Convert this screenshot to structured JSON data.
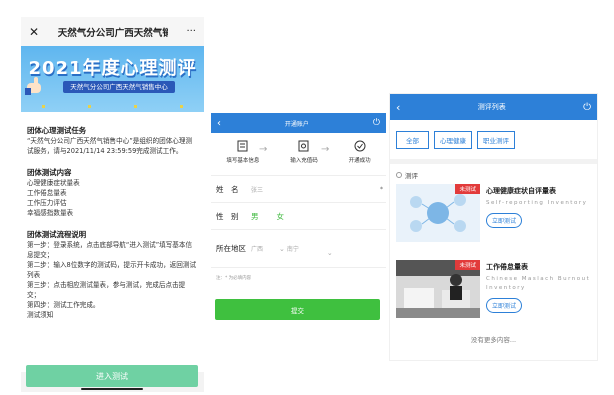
{
  "screen1": {
    "title": "天然气分公司广西天然气销",
    "banner_title": "2021年度心理测评",
    "banner_subtitle": "天然气分公司广西天然气销售中心",
    "sections": [
      {
        "heading": "团体心理测试任务",
        "lines": [
          "“天然气分公司广西天然气销售中心”是组织的团体心理测试服务，请与2021/11/14 23:59:59完成测试工作。"
        ]
      },
      {
        "heading": "团体测试内容",
        "lines": [
          "心理健康症状量表",
          "工作倦怠量表",
          "工作压力评估",
          "幸福感指数量表"
        ]
      },
      {
        "heading": "团体测试流程说明",
        "lines": [
          "第一步：登录系统，点击底部导航“进入测试”填写基本信息提交；",
          "第二步：输入8位数字的测试码，提示开卡成功，返回测试列表",
          "第三步：点击相应测试量表，参与测试，完成后点击提交；",
          "第四步：测试工作完成。",
          "测试须知"
        ]
      }
    ],
    "enter_button": "进入测试"
  },
  "screen2": {
    "title": "开通账户",
    "steps": [
      "填写基本信息",
      "输入充值码",
      "开通成功"
    ],
    "name_label": "姓　名",
    "name_placeholder": "张三",
    "required_mark": "*",
    "gender_label": "性　别",
    "gender_male": "男",
    "gender_female": "女",
    "region_label": "所在地区",
    "province": "广西",
    "city": "南宁",
    "note": "注：* 为必填内容",
    "submit": "提交"
  },
  "screen3": {
    "title": "测评列表",
    "filters": [
      "全部",
      "心理健康",
      "职业测评"
    ],
    "section": "测评",
    "items": [
      {
        "badge": "未测试",
        "title": "心理健康症状自评量表",
        "subtitle": "Self-reporting Inventory",
        "button": "立即测试"
      },
      {
        "badge": "未测试",
        "title": "工作倦怠量表",
        "subtitle": "Chinese Maslach Burnout Inventory",
        "button": "立即测试"
      }
    ],
    "more": "没有更多内容..."
  },
  "colors": {
    "blue_bar": "#2d80d8",
    "green": "#3fc03f",
    "mint": "#6fd1a3",
    "badge_red": "#e23b3b"
  },
  "icons": [
    "close-icon",
    "more-icon",
    "back-icon",
    "power-icon",
    "form-icon",
    "code-icon",
    "check-circle-icon",
    "chevron-down-icon"
  ]
}
